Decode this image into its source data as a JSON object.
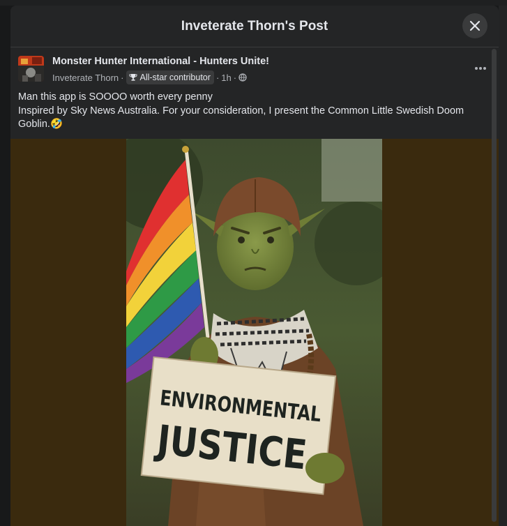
{
  "dialog": {
    "title": "Inveterate Thorn's Post",
    "close_icon": "close-icon"
  },
  "post": {
    "group_name": "Monster Hunter International - Hunters Unite!",
    "author": "Inveterate Thorn",
    "separator": "·",
    "badge_icon": "trophy-icon",
    "badge_label": "All-star contributor",
    "time": "1h",
    "audience_icon": "globe-icon",
    "more_icon": "more-options-icon",
    "text_line_1": "Man this app is SOOOO worth every penny",
    "text_line_2": "Inspired by Sky News Australia. For your consideration, I present the Common Little Swedish Doom Goblin.🤣"
  },
  "image": {
    "sign_line_1": "ENVIRONMENTAL",
    "sign_line_2": "JUSTICE"
  },
  "colors": {
    "background": "#18191a",
    "dialog": "#242526",
    "text": "#e4e6eb",
    "muted": "#b0b3b8",
    "image_letterbox": "#3a2a0e"
  }
}
